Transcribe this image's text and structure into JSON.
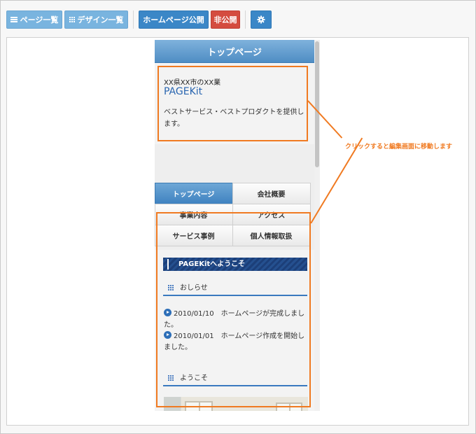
{
  "toolbar": {
    "page_list": "ページ一覧",
    "design_list": "デザイン一覧",
    "publish": "ホームページ公開",
    "unpublish": "非公開",
    "settings_icon": "gear-icon"
  },
  "phone": {
    "header_title": "トップページ",
    "intro": {
      "subtitle": "XX県XX市のXX業",
      "logo": "PAGEKit",
      "description": "ベストサービス・ベストプロダクトを提供します。"
    },
    "nav": [
      {
        "label": "トップページ",
        "active": true
      },
      {
        "label": "会社概要",
        "active": false
      },
      {
        "label": "事業内容",
        "active": false
      },
      {
        "label": "アクセス",
        "active": false
      },
      {
        "label": "サービス事例",
        "active": false
      },
      {
        "label": "個人情報取扱",
        "active": false
      }
    ],
    "welcome": "PAGEKitへようこそ",
    "news_heading": "おしらせ",
    "news": [
      {
        "date": "2010/01/10",
        "text": "ホームページが完成しました。"
      },
      {
        "date": "2010/01/01",
        "text": "ホームページ作成を開始しました。"
      }
    ],
    "welcome_heading": "ようこそ"
  },
  "callout": "クリックすると編集画面に移動します",
  "colors": {
    "accent_blue": "#3b87c7",
    "danger_red": "#d44c3f",
    "highlight_orange": "#f07a21"
  }
}
